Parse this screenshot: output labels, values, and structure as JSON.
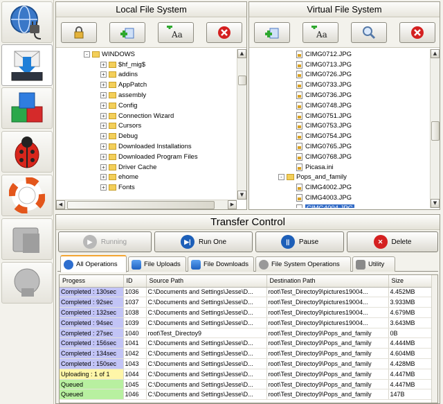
{
  "launcher": {
    "items": [
      {
        "name": "network",
        "icon": "globe-plug-icon"
      },
      {
        "name": "transfer",
        "icon": "download-tray-icon"
      },
      {
        "name": "modules",
        "icon": "colored-cubes-icon"
      },
      {
        "name": "debug",
        "icon": "ladybug-icon"
      },
      {
        "name": "help",
        "icon": "lifebuoy-icon"
      },
      {
        "name": "disk",
        "icon": "gray-disk-icon"
      },
      {
        "name": "disk-alt",
        "icon": "gray-disk-icon"
      }
    ]
  },
  "local": {
    "title": "Local File System",
    "tree": [
      {
        "label": "WINDOWS",
        "kind": "folder",
        "exp": "-"
      },
      {
        "label": "$hf_mig$",
        "kind": "folder",
        "exp": "+"
      },
      {
        "label": "addins",
        "kind": "folder",
        "exp": "+"
      },
      {
        "label": "AppPatch",
        "kind": "folder",
        "exp": "+"
      },
      {
        "label": "assembly",
        "kind": "folder",
        "exp": "+"
      },
      {
        "label": "Config",
        "kind": "folder",
        "exp": "+"
      },
      {
        "label": "Connection Wizard",
        "kind": "folder",
        "exp": "+"
      },
      {
        "label": "Cursors",
        "kind": "folder",
        "exp": "+"
      },
      {
        "label": "Debug",
        "kind": "folder",
        "exp": "+"
      },
      {
        "label": "Downloaded Installations",
        "kind": "folder",
        "exp": "+"
      },
      {
        "label": "Downloaded Program Files",
        "kind": "folder",
        "exp": "+"
      },
      {
        "label": "Driver Cache",
        "kind": "folder",
        "exp": "+"
      },
      {
        "label": "ehome",
        "kind": "folder",
        "exp": "+"
      },
      {
        "label": "Fonts",
        "kind": "folder",
        "exp": "+"
      }
    ]
  },
  "virtual": {
    "title": "Virtual File System",
    "tree": [
      {
        "label": "CIMG0712.JPG",
        "kind": "file"
      },
      {
        "label": "CIMG0713.JPG",
        "kind": "file"
      },
      {
        "label": "CIMG0726.JPG",
        "kind": "file"
      },
      {
        "label": "CIMG0733.JPG",
        "kind": "file"
      },
      {
        "label": "CIMG0736.JPG",
        "kind": "file"
      },
      {
        "label": "CIMG0748.JPG",
        "kind": "file"
      },
      {
        "label": "CIMG0751.JPG",
        "kind": "file"
      },
      {
        "label": "CIMG0753.JPG",
        "kind": "file"
      },
      {
        "label": "CIMG0754.JPG",
        "kind": "file"
      },
      {
        "label": "CIMG0765.JPG",
        "kind": "file"
      },
      {
        "label": "CIMG0768.JPG",
        "kind": "file"
      },
      {
        "label": "Picasa.ini",
        "kind": "file"
      },
      {
        "label": "Pops_and_family",
        "kind": "folder",
        "exp": "-"
      },
      {
        "label": "CIMG4002.JPG",
        "kind": "file"
      },
      {
        "label": "CIMG4003.JPG",
        "kind": "file"
      },
      {
        "label": "CIMG4004.JPG",
        "kind": "file",
        "selected": true
      }
    ]
  },
  "transfer": {
    "title": "Transfer Control",
    "running_label": "Running",
    "run_one_label": "Run One",
    "pause_label": "Pause",
    "delete_label": "Delete",
    "tabs": [
      {
        "label": "All Operations",
        "icon": "globe-icon"
      },
      {
        "label": "File Uploads",
        "icon": "upload-arrow-icon"
      },
      {
        "label": "File Downloads",
        "icon": "download-arrow-icon"
      },
      {
        "label": "File System Operations",
        "icon": "gear-icon"
      },
      {
        "label": "Utility",
        "icon": "wrench-icon"
      }
    ],
    "columns": [
      "Progess",
      "ID",
      "Source Path",
      "Destination Path",
      "Size"
    ],
    "rows": [
      {
        "progress": "Completed : 130sec",
        "status": "completed",
        "id": "1036",
        "src": "C:\\Documents and Settings\\Jesse\\D...",
        "dst": "root\\Test_Directoy9\\pictures19004...",
        "size": "4.452MB"
      },
      {
        "progress": "Completed : 92sec",
        "status": "completed",
        "id": "1037",
        "src": "C:\\Documents and Settings\\Jesse\\D...",
        "dst": "root\\Test_Directoy9\\pictures19004...",
        "size": "3.933MB"
      },
      {
        "progress": "Completed : 132sec",
        "status": "completed",
        "id": "1038",
        "src": "C:\\Documents and Settings\\Jesse\\D...",
        "dst": "root\\Test_Directoy9\\pictures19004...",
        "size": "4.679MB"
      },
      {
        "progress": "Completed : 94sec",
        "status": "completed",
        "id": "1039",
        "src": "C:\\Documents and Settings\\Jesse\\D...",
        "dst": "root\\Test_Directoy9\\pictures19004...",
        "size": "3.643MB"
      },
      {
        "progress": "Completed : 27sec",
        "status": "completed",
        "id": "1040",
        "src": "root\\Test_Directoy9",
        "dst": "root\\Test_Directoy9\\Pops_and_family",
        "size": "0B"
      },
      {
        "progress": "Completed : 156sec",
        "status": "completed",
        "id": "1041",
        "src": "C:\\Documents and Settings\\Jesse\\D...",
        "dst": "root\\Test_Directoy9\\Pops_and_family",
        "size": "4.444MB"
      },
      {
        "progress": "Completed : 134sec",
        "status": "completed",
        "id": "1042",
        "src": "C:\\Documents and Settings\\Jesse\\D...",
        "dst": "root\\Test_Directoy9\\Pops_and_family",
        "size": "4.604MB"
      },
      {
        "progress": "Completed : 150sec",
        "status": "completed",
        "id": "1043",
        "src": "C:\\Documents and Settings\\Jesse\\D...",
        "dst": "root\\Test_Directoy9\\Pops_and_family",
        "size": "4.428MB"
      },
      {
        "progress": "Uploading : 1 of 1",
        "status": "uploading",
        "id": "1044",
        "src": "C:\\Documents and Settings\\Jesse\\D...",
        "dst": "root\\Test_Directoy9\\Pops_and_family",
        "size": "4.447MB"
      },
      {
        "progress": "Queued",
        "status": "queued",
        "id": "1045",
        "src": "C:\\Documents and Settings\\Jesse\\D...",
        "dst": "root\\Test_Directoy9\\Pops_and_family",
        "size": "4.447MB"
      },
      {
        "progress": "Queued",
        "status": "queued",
        "id": "1046",
        "src": "C:\\Documents and Settings\\Jesse\\D...",
        "dst": "root\\Test_Directoy9\\Pops_and_family",
        "size": "147B"
      }
    ]
  }
}
